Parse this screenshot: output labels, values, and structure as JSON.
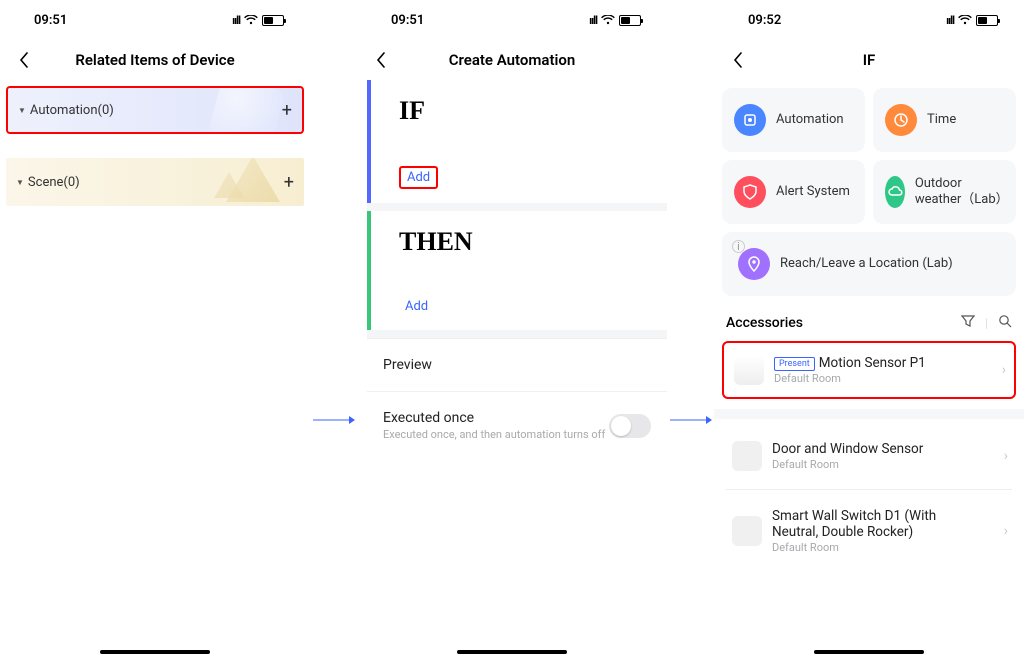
{
  "status": {
    "time1": "09:51",
    "time2": "09:51",
    "time3": "09:52"
  },
  "screen1": {
    "title": "Related Items of Device",
    "automation_label": "Automation(0)",
    "scene_label": "Scene(0)",
    "plus": "+"
  },
  "screen2": {
    "title": "Create Automation",
    "if_label": "IF",
    "then_label": "THEN",
    "add": "Add",
    "preview": "Preview",
    "exec_title": "Executed once",
    "exec_sub": "Executed once, and then automation turns off"
  },
  "screen3": {
    "title": "IF",
    "opts": {
      "automation": "Automation",
      "time": "Time",
      "alert": "Alert System",
      "weather": "Outdoor weather（Lab）",
      "reach": "Reach/Leave a Location (Lab)"
    },
    "accessories_label": "Accessories",
    "items": {
      "motion_badge": "Present",
      "motion_name": "Motion Sensor P1",
      "motion_room": "Default Room",
      "door_name": "Door and Window Sensor",
      "door_room": "Default Room",
      "switch_name": "Smart Wall Switch D1 (With Neutral, Double Rocker)",
      "switch_room": "Default Room"
    }
  }
}
